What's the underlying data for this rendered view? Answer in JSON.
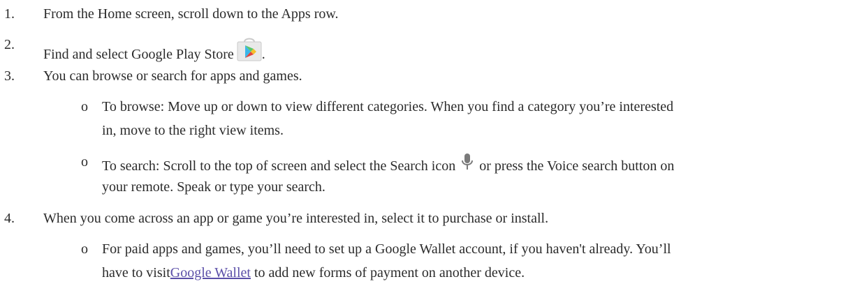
{
  "steps": [
    {
      "num": "1.",
      "text": "From the Home screen, scroll down to the Apps row."
    },
    {
      "num": "2.",
      "text": "Find and select Google Play Store",
      "after_icon": ".",
      "icon": "google-play-store-icon"
    },
    {
      "num": "3.",
      "text": "You can browse or search for apps and games."
    },
    {
      "num": "4.",
      "text": "When you come across an app or game you’re interested in, select it to purchase or install."
    }
  ],
  "bullet_marker": "o",
  "browse": {
    "line1": "To browse: Move up or down to view different categories. When you find a category you’re interested",
    "line2": "in, move to the right view items."
  },
  "search": {
    "line1_before": "To search: Scroll to the top of screen and select the Search icon",
    "icon": "microphone-icon",
    "line1_after": "or press the Voice search button on",
    "line2": "your remote. Speak or type your search."
  },
  "wallet": {
    "line1": "For paid apps and games, you’ll need to set up a Google Wallet account, if you haven't already. You’ll",
    "line2_before": "have to visit",
    "link_text": "Google Wallet",
    "line2_after": " to add new forms of payment on another device."
  },
  "colors": {
    "text": "#2b2b2b",
    "link": "#5b4fa8"
  }
}
